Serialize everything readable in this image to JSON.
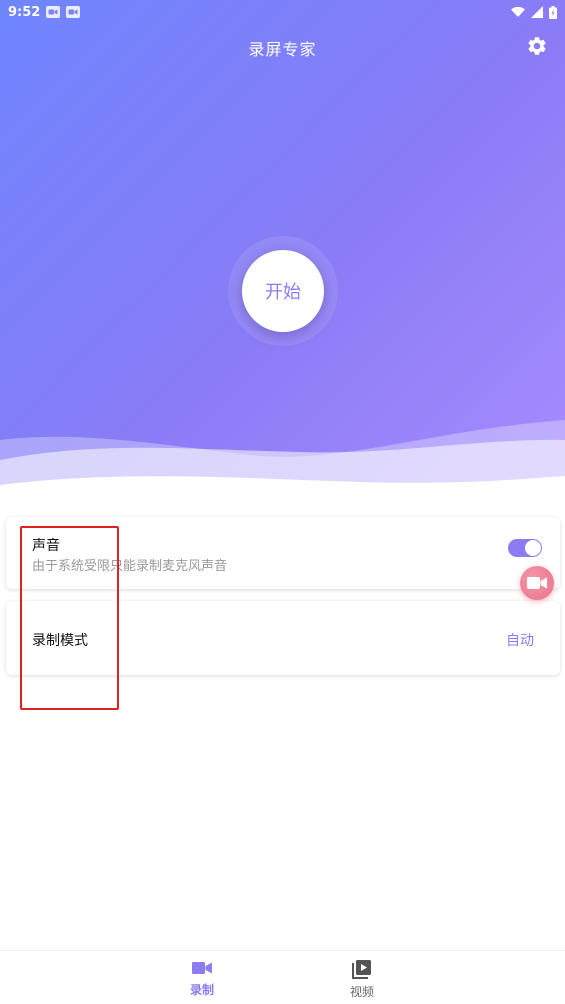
{
  "status_bar": {
    "time": "9:52",
    "left_icons": [
      "video-camera-icon",
      "video-camera-icon"
    ],
    "right_icons": [
      "wifi-icon",
      "signal-icon",
      "battery-icon"
    ]
  },
  "header": {
    "title": "录屏专家",
    "settings_icon": "gear-icon"
  },
  "hero": {
    "start_label": "开始"
  },
  "sound_card": {
    "title": "声音",
    "subtitle": "由于系统受限只能录制麦克风声音",
    "toggle_on": true
  },
  "mode_card": {
    "title": "录制模式",
    "value": "自动"
  },
  "floating_button": {
    "icon": "video-camera-icon"
  },
  "bottom_nav": {
    "items": [
      {
        "label": "录制",
        "icon": "video-camera-icon",
        "active": true
      },
      {
        "label": "视频",
        "icon": "video-library-icon",
        "active": false
      }
    ]
  },
  "colors": {
    "accent": "#8c7cf2",
    "hero_start": "#6f86ff",
    "hero_end": "#a98bff",
    "float_button": "#ea6f89",
    "annotation": "#e0211e"
  }
}
